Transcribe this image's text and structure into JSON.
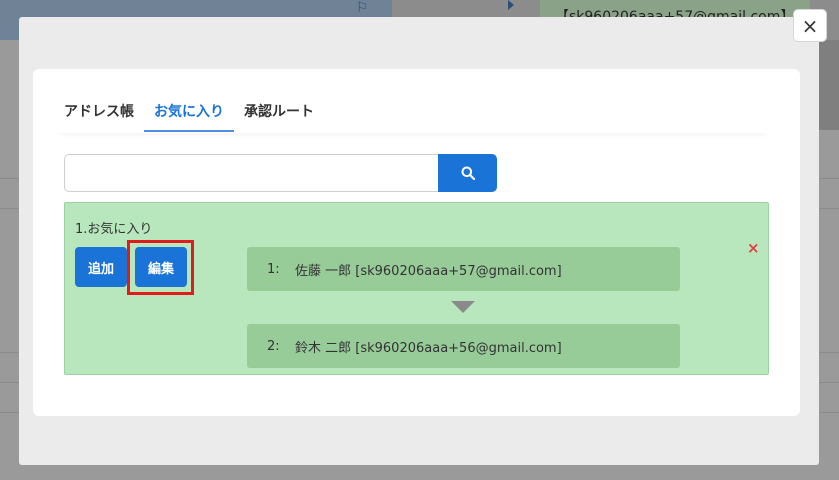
{
  "background": {
    "header_text": "【sk960206aaa+57@gmail.com】"
  },
  "modal": {
    "close_label": "×"
  },
  "tabs": [
    {
      "label": "アドレス帳",
      "active": false
    },
    {
      "label": "お気に入り",
      "active": true
    },
    {
      "label": "承認ルート",
      "active": false
    }
  ],
  "search": {
    "value": "",
    "placeholder": ""
  },
  "favorites": {
    "title": "1.お気に入り",
    "add_label": "追加",
    "edit_label": "編集",
    "remove_label": "×",
    "entries": [
      {
        "num": "1:",
        "text": "佐藤 一郎 [sk960206aaa+57@gmail.com]"
      },
      {
        "num": "2:",
        "text": "鈴木 二郎 [sk960206aaa+56@gmail.com]"
      }
    ]
  },
  "colors": {
    "accent": "#1a73d6",
    "favorites_bg": "#b8e6bd",
    "entry_bg": "#97cc98",
    "highlight": "#e01b1b"
  }
}
